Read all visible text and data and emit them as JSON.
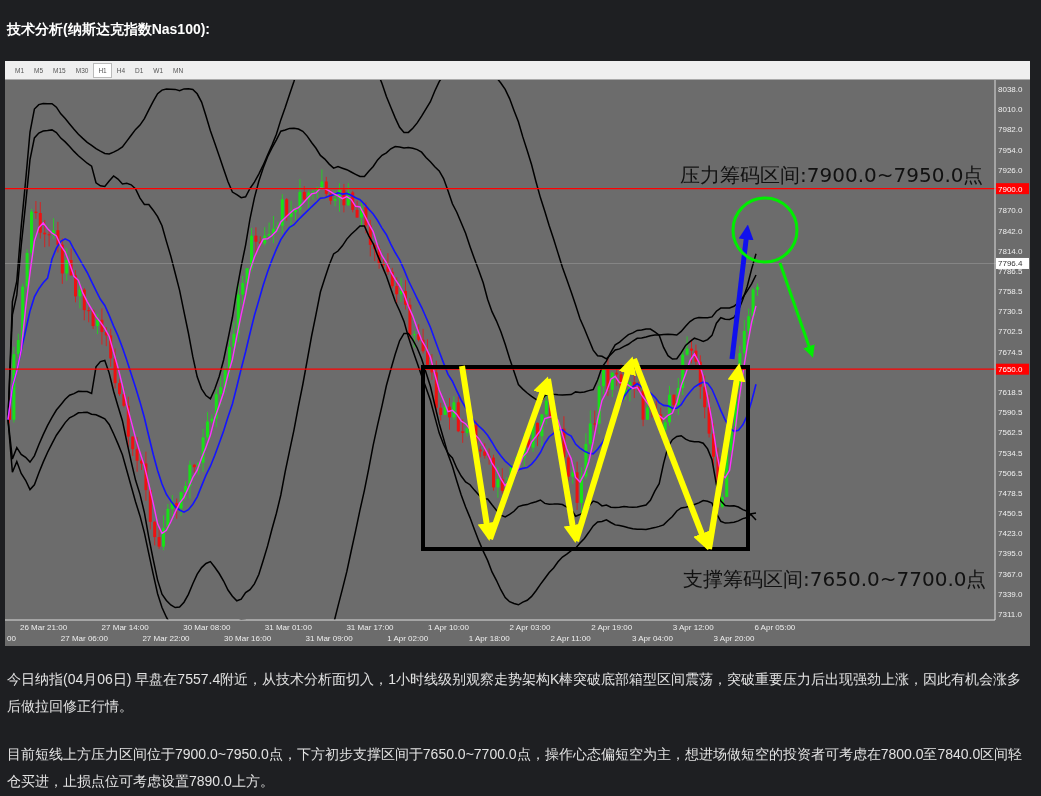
{
  "article_title": "技术分析(纳斯达克指数Nas100):",
  "chart": {
    "timeframes": [
      {
        "label": "M1",
        "selected": false
      },
      {
        "label": "M5",
        "selected": false
      },
      {
        "label": "M15",
        "selected": false
      },
      {
        "label": "M30",
        "selected": false
      },
      {
        "label": "H1",
        "selected": true
      },
      {
        "label": "H4",
        "selected": false
      },
      {
        "label": "D1",
        "selected": false
      },
      {
        "label": "W1",
        "selected": false
      },
      {
        "label": "MN",
        "selected": false
      }
    ],
    "price_ticks": [
      "8038.0",
      "8010.0",
      "7982.0",
      "7954.0",
      "7926.0",
      "7870.0",
      "7842.0",
      "7814.0",
      "7786.5",
      "7758.5",
      "7730.5",
      "7702.5",
      "7674.5",
      "7618.5",
      "7590.5",
      "7562.5",
      "7534.5",
      "7506.5",
      "7478.5",
      "7450.5",
      "7423.0",
      "7395.0",
      "7367.0",
      "7339.0",
      "7311.0"
    ],
    "price_markers": [
      {
        "label": "7900.0",
        "kind": "resistance"
      },
      {
        "label": "7796.4",
        "kind": "current"
      },
      {
        "label": "7650.0",
        "kind": "support"
      }
    ],
    "time_ticks": [
      "00",
      "26 Mar 21:00",
      "27 Mar 06:00",
      "27 Mar 14:00",
      "27 Mar 22:00",
      "30 Mar 08:00",
      "30 Mar 16:00",
      "31 Mar 01:00",
      "31 Mar 09:00",
      "31 Mar 17:00",
      "1 Apr 02:00",
      "1 Apr 10:00",
      "1 Apr 18:00",
      "2 Apr 03:00",
      "2 Apr 11:00",
      "2 Apr 19:00",
      "3 Apr 04:00",
      "3 Apr 12:00",
      "3 Apr 20:00",
      "6 Apr 05:00"
    ],
    "annotations": [
      {
        "text": "压力筹码区间:7900.0~7950.0点",
        "kind": "resistance"
      },
      {
        "text": "支撑筹码区间:7650.0~7700.0点",
        "kind": "support"
      }
    ]
  },
  "paragraphs": [
    "今日纳指(04月06日) 早盘在7557.4附近，从技术分析面切入，1小时线级别观察走势架构K棒突破底部箱型区间震荡，突破重要压力后出现强劲上涨，因此有机会涨多后做拉回修正行情。",
    "目前短线上方压力区间位于7900.0~7950.0点，下方初步支撑区间于7650.0~7700.0点，操作心态偏短空为主，想进场做短空的投资者可考虑在7800.0至7840.0区间轻仓买进，止损点位可考虑设置7890.0上方。"
  ]
}
